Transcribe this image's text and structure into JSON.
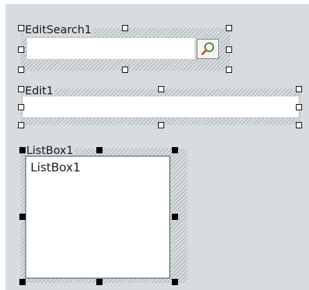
{
  "designer": {
    "edit_search": {
      "caption": "EditSearch1",
      "value": "",
      "button_icon": "magnifier-icon"
    },
    "edit": {
      "caption": "Edit1",
      "value": ""
    },
    "listbox": {
      "caption": "ListBox1",
      "items": [
        "ListBox1"
      ]
    }
  }
}
